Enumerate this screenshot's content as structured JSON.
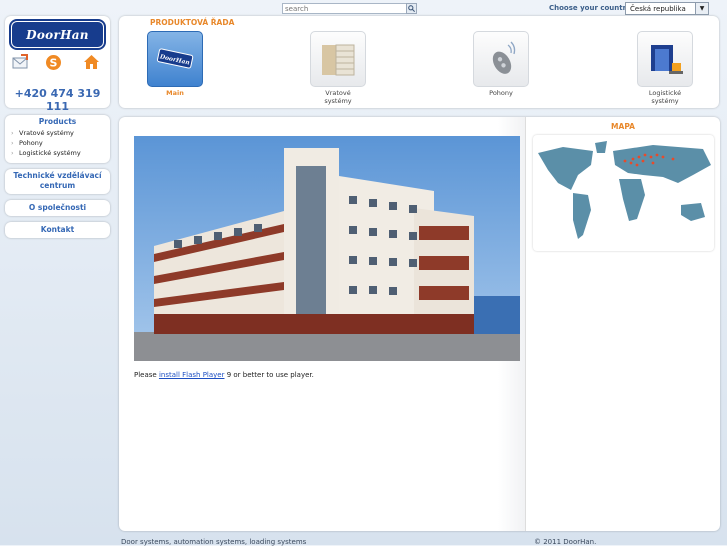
{
  "search": {
    "placeholder": "search"
  },
  "country": {
    "label": "Choose your country",
    "selected": "Česká republika"
  },
  "logo": {
    "text": "DoorHan"
  },
  "contact": {
    "phone": "+420 474 319 111"
  },
  "header_icons": [
    "mail-icon",
    "skype-icon",
    "home-icon"
  ],
  "nav": {
    "products_title": "Products",
    "products_items": [
      "Vratové systémy",
      "Pohony",
      "Logistické systémy"
    ],
    "training_line1": "Technické vzdělávací",
    "training_line2": "centrum",
    "about": "O společnosti",
    "contact": "Kontakt"
  },
  "product_range": {
    "title": "PRODUKTOVÁ ŘADA",
    "items": [
      {
        "label_line1": "Main",
        "label_line2": "",
        "active": true
      },
      {
        "label_line1": "Vratové",
        "label_line2": "systémy",
        "active": false
      },
      {
        "label_line1": "Pohony",
        "label_line2": "",
        "active": false
      },
      {
        "label_line1": "Logistické",
        "label_line2": "systémy",
        "active": false
      }
    ]
  },
  "main": {
    "flash_prefix": "Please ",
    "flash_link": "install Flash Player",
    "flash_suffix": " 9 or better to use player."
  },
  "map": {
    "title": "MAPA"
  },
  "footer": {
    "left": "Door systems, automation systems, loading systems",
    "right": "© 2011 DoorHan."
  },
  "colors": {
    "accent": "#e8882b",
    "brand": "#173c8d",
    "link": "#3568b5"
  }
}
